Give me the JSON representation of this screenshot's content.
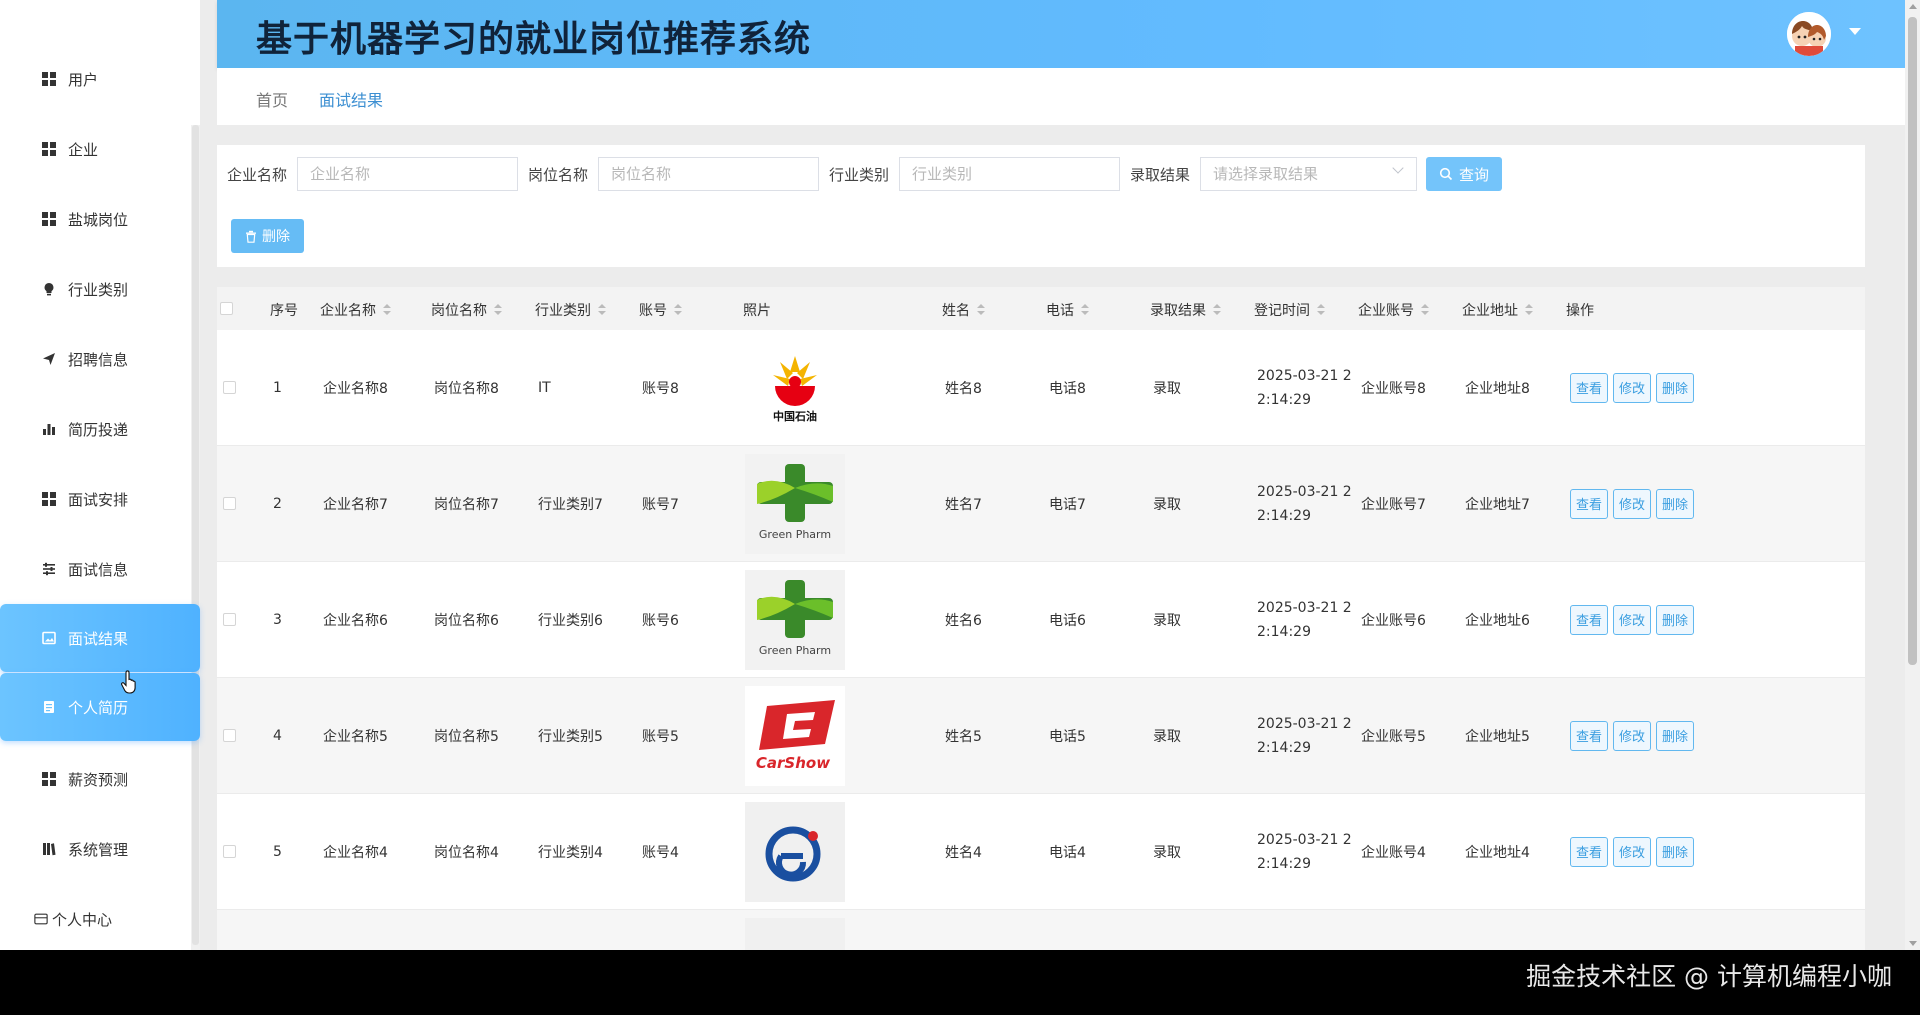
{
  "header": {
    "title": "基于机器学习的就业岗位推荐系统"
  },
  "sidebar": {
    "items": [
      {
        "label": "用户",
        "icon": "grid-icon"
      },
      {
        "label": "企业",
        "icon": "grid-icon"
      },
      {
        "label": "盐城岗位",
        "icon": "grid-icon"
      },
      {
        "label": "行业类别",
        "icon": "bulb-icon"
      },
      {
        "label": "招聘信息",
        "icon": "send-icon"
      },
      {
        "label": "简历投递",
        "icon": "bar-chart-icon"
      },
      {
        "label": "面试安排",
        "icon": "grid-icon"
      },
      {
        "label": "面试信息",
        "icon": "sliders-icon"
      },
      {
        "label": "面试结果",
        "icon": "picture-icon",
        "active": true
      },
      {
        "label": "个人简历",
        "icon": "document-icon",
        "active": true
      },
      {
        "label": "薪资预测",
        "icon": "grid-icon"
      },
      {
        "label": "系统管理",
        "icon": "library-icon"
      },
      {
        "label": "个人中心",
        "icon": "window-icon"
      }
    ]
  },
  "breadcrumb": {
    "home": "首页",
    "current": "面试结果"
  },
  "search": {
    "company_label": "企业名称",
    "company_placeholder": "企业名称",
    "position_label": "岗位名称",
    "position_placeholder": "岗位名称",
    "industry_label": "行业类别",
    "industry_placeholder": "行业类别",
    "result_label": "录取结果",
    "result_placeholder": "请选择录取结果",
    "query_button": "查询",
    "delete_button": "删除"
  },
  "table": {
    "columns": [
      "序号",
      "企业名称",
      "岗位名称",
      "行业类别",
      "账号",
      "照片",
      "姓名",
      "电话",
      "录取结果",
      "登记时间",
      "企业账号",
      "企业地址",
      "操作"
    ],
    "rows": [
      {
        "index": "1",
        "company": "企业名称8",
        "position": "岗位名称8",
        "industry": "IT",
        "account": "账号8",
        "logo": "中国石油",
        "name": "姓名8",
        "phone": "电话8",
        "result": "录取",
        "time": "2025-03-21 22:14:29",
        "company_account": "企业账号8",
        "address": "企业地址8"
      },
      {
        "index": "2",
        "company": "企业名称7",
        "position": "岗位名称7",
        "industry": "行业类别7",
        "account": "账号7",
        "logo": "Green Pharm",
        "name": "姓名7",
        "phone": "电话7",
        "result": "录取",
        "time": "2025-03-21 22:14:29",
        "company_account": "企业账号7",
        "address": "企业地址7"
      },
      {
        "index": "3",
        "company": "企业名称6",
        "position": "岗位名称6",
        "industry": "行业类别6",
        "account": "账号6",
        "logo": "Green Pharm",
        "name": "姓名6",
        "phone": "电话6",
        "result": "录取",
        "time": "2025-03-21 22:14:29",
        "company_account": "企业账号6",
        "address": "企业地址6"
      },
      {
        "index": "4",
        "company": "企业名称5",
        "position": "岗位名称5",
        "industry": "行业类别5",
        "account": "账号5",
        "logo": "CarShow",
        "name": "姓名5",
        "phone": "电话5",
        "result": "录取",
        "time": "2025-03-21 22:14:29",
        "company_account": "企业账号5",
        "address": "企业地址5"
      },
      {
        "index": "5",
        "company": "企业名称4",
        "position": "岗位名称4",
        "industry": "行业类别4",
        "account": "账号4",
        "logo": "",
        "name": "姓名4",
        "phone": "电话4",
        "result": "录取",
        "time": "2025-03-21 22:14:29",
        "company_account": "企业账号4",
        "address": "企业地址4"
      }
    ],
    "actions": {
      "view": "查看",
      "edit": "修改",
      "delete": "删除"
    }
  },
  "watermark": "掘金技术社区 @ 计算机编程小咖",
  "colors": {
    "accent": "#5bb6f0",
    "active_menu": "#4fb2ff",
    "title_text": "#10233a"
  }
}
